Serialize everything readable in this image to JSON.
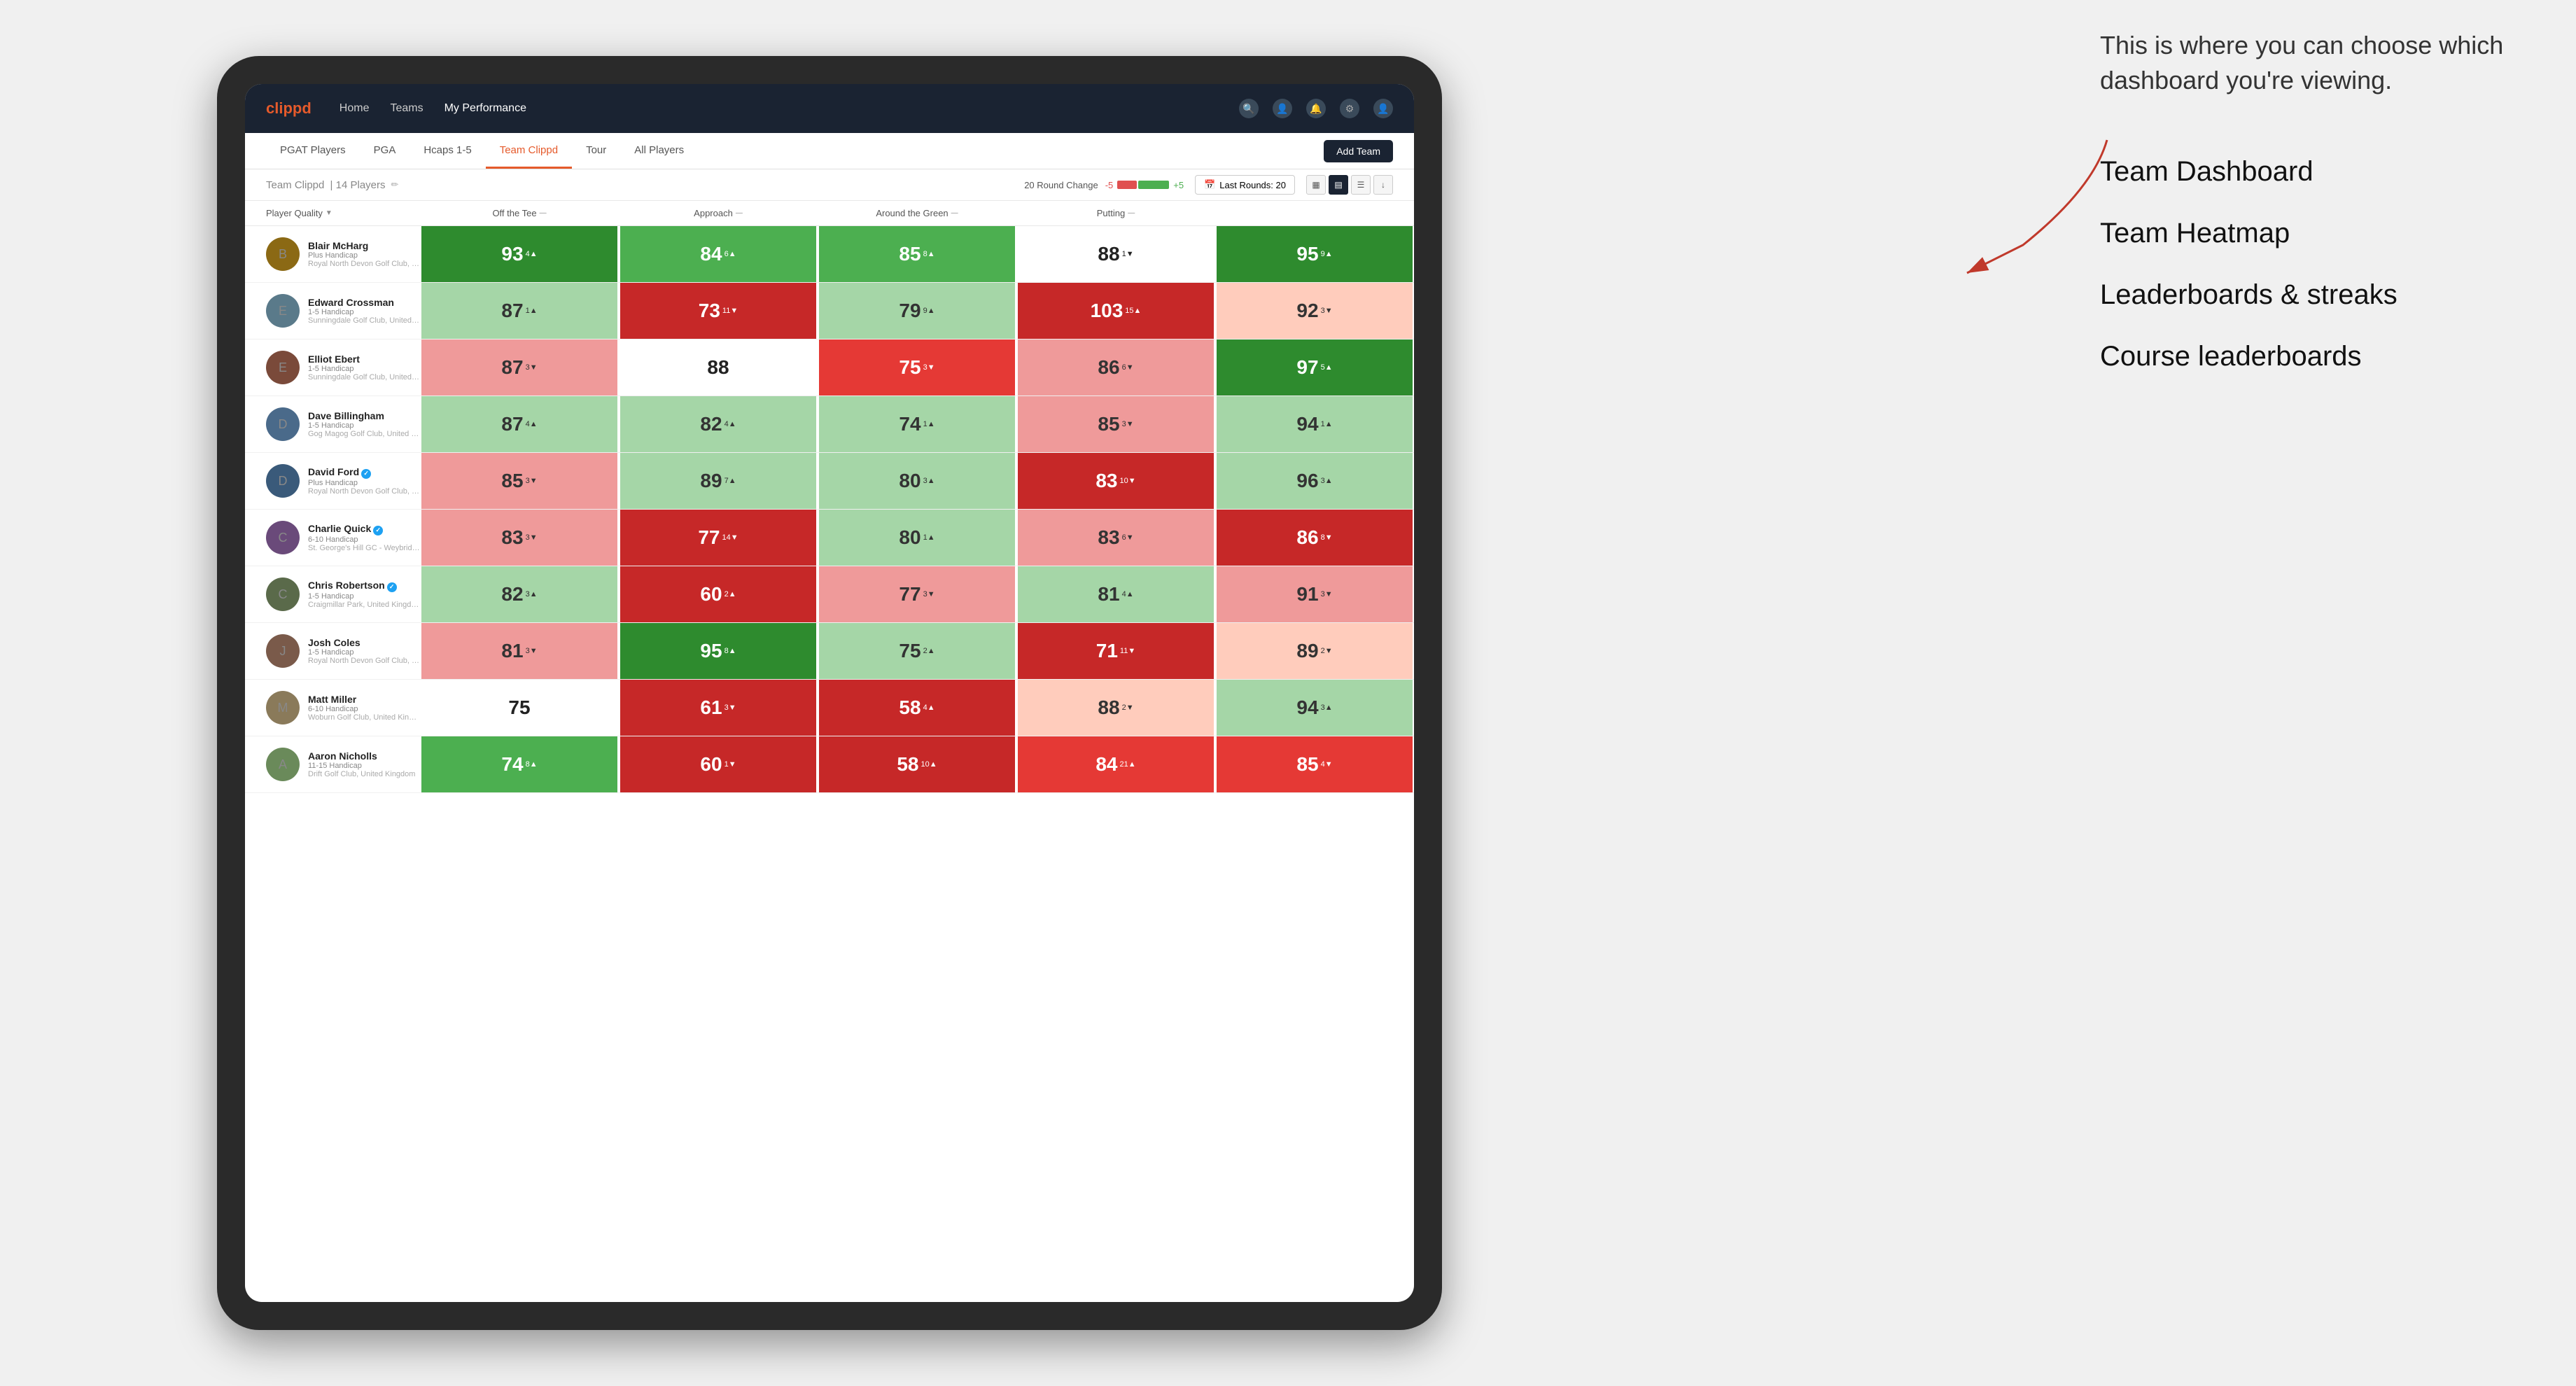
{
  "annotation": {
    "intro": "This is where you can choose which dashboard you're viewing.",
    "items": [
      "Team Dashboard",
      "Team Heatmap",
      "Leaderboards & streaks",
      "Course leaderboards"
    ]
  },
  "navbar": {
    "brand": "clippd",
    "links": [
      "Home",
      "Teams",
      "My Performance"
    ]
  },
  "subnav": {
    "tabs": [
      "PGAT Players",
      "PGA",
      "Hcaps 1-5",
      "Team Clippd",
      "Tour",
      "All Players"
    ],
    "active": "Team Clippd",
    "add_button": "Add Team"
  },
  "team_header": {
    "title": "Team Clippd",
    "count": "14 Players",
    "round_change_label": "20 Round Change",
    "round_change_neg": "-5",
    "round_change_pos": "+5",
    "last_rounds_label": "Last Rounds:",
    "last_rounds_value": "20"
  },
  "columns": {
    "player": "Player Quality",
    "tee": "Off the Tee",
    "approach": "Approach",
    "around": "Around the Green",
    "putting": "Putting"
  },
  "players": [
    {
      "name": "Blair McHarg",
      "handicap": "Plus Handicap",
      "club": "Royal North Devon Golf Club, United Kingdom",
      "avatar_color": "#8B6914",
      "scores": {
        "quality": {
          "val": "93",
          "change": "4",
          "dir": "up",
          "color": "green-dark"
        },
        "tee": {
          "val": "84",
          "change": "6",
          "dir": "up",
          "color": "green-med"
        },
        "approach": {
          "val": "85",
          "change": "8",
          "dir": "up",
          "color": "green-med"
        },
        "around": {
          "val": "88",
          "change": "1",
          "dir": "down",
          "color": "white"
        },
        "putting": {
          "val": "95",
          "change": "9",
          "dir": "up",
          "color": "green-dark"
        }
      }
    },
    {
      "name": "Edward Crossman",
      "handicap": "1-5 Handicap",
      "club": "Sunningdale Golf Club, United Kingdom",
      "avatar_color": "#5a7a8a",
      "scores": {
        "quality": {
          "val": "87",
          "change": "1",
          "dir": "up",
          "color": "green-light"
        },
        "tee": {
          "val": "73",
          "change": "11",
          "dir": "down",
          "color": "red-dark"
        },
        "approach": {
          "val": "79",
          "change": "9",
          "dir": "up",
          "color": "green-light"
        },
        "around": {
          "val": "103",
          "change": "15",
          "dir": "up",
          "color": "red-dark"
        },
        "putting": {
          "val": "92",
          "change": "3",
          "dir": "down",
          "color": "salmon"
        }
      }
    },
    {
      "name": "Elliot Ebert",
      "handicap": "1-5 Handicap",
      "club": "Sunningdale Golf Club, United Kingdom",
      "avatar_color": "#7a4a3a",
      "scores": {
        "quality": {
          "val": "87",
          "change": "3",
          "dir": "down",
          "color": "red-light"
        },
        "tee": {
          "val": "88",
          "change": "",
          "dir": "",
          "color": "white"
        },
        "approach": {
          "val": "75",
          "change": "3",
          "dir": "down",
          "color": "red-med"
        },
        "around": {
          "val": "86",
          "change": "6",
          "dir": "down",
          "color": "red-light"
        },
        "putting": {
          "val": "97",
          "change": "5",
          "dir": "up",
          "color": "green-dark"
        }
      }
    },
    {
      "name": "Dave Billingham",
      "handicap": "1-5 Handicap",
      "club": "Gog Magog Golf Club, United Kingdom",
      "avatar_color": "#4a6a8a",
      "scores": {
        "quality": {
          "val": "87",
          "change": "4",
          "dir": "up",
          "color": "green-light"
        },
        "tee": {
          "val": "82",
          "change": "4",
          "dir": "up",
          "color": "green-light"
        },
        "approach": {
          "val": "74",
          "change": "1",
          "dir": "up",
          "color": "green-light"
        },
        "around": {
          "val": "85",
          "change": "3",
          "dir": "down",
          "color": "red-light"
        },
        "putting": {
          "val": "94",
          "change": "1",
          "dir": "up",
          "color": "green-light"
        }
      }
    },
    {
      "name": "David Ford",
      "handicap": "Plus Handicap",
      "club": "Royal North Devon Golf Club, United Kingdom",
      "avatar_color": "#3a5a7a",
      "verified": true,
      "scores": {
        "quality": {
          "val": "85",
          "change": "3",
          "dir": "down",
          "color": "red-light"
        },
        "tee": {
          "val": "89",
          "change": "7",
          "dir": "up",
          "color": "green-light"
        },
        "approach": {
          "val": "80",
          "change": "3",
          "dir": "up",
          "color": "green-light"
        },
        "around": {
          "val": "83",
          "change": "10",
          "dir": "down",
          "color": "red-dark"
        },
        "putting": {
          "val": "96",
          "change": "3",
          "dir": "up",
          "color": "green-light"
        }
      }
    },
    {
      "name": "Charlie Quick",
      "handicap": "6-10 Handicap",
      "club": "St. George's Hill GC - Weybridge - Surrey, Uni...",
      "avatar_color": "#6a4a7a",
      "verified": true,
      "scores": {
        "quality": {
          "val": "83",
          "change": "3",
          "dir": "down",
          "color": "red-light"
        },
        "tee": {
          "val": "77",
          "change": "14",
          "dir": "down",
          "color": "red-dark"
        },
        "approach": {
          "val": "80",
          "change": "1",
          "dir": "up",
          "color": "green-light"
        },
        "around": {
          "val": "83",
          "change": "6",
          "dir": "down",
          "color": "red-light"
        },
        "putting": {
          "val": "86",
          "change": "8",
          "dir": "down",
          "color": "red-dark"
        }
      }
    },
    {
      "name": "Chris Robertson",
      "handicap": "1-5 Handicap",
      "club": "Craigmillar Park, United Kingdom",
      "avatar_color": "#5a6a4a",
      "verified": true,
      "scores": {
        "quality": {
          "val": "82",
          "change": "3",
          "dir": "up",
          "color": "green-light"
        },
        "tee": {
          "val": "60",
          "change": "2",
          "dir": "up",
          "color": "red-dark"
        },
        "approach": {
          "val": "77",
          "change": "3",
          "dir": "down",
          "color": "red-light"
        },
        "around": {
          "val": "81",
          "change": "4",
          "dir": "up",
          "color": "green-light"
        },
        "putting": {
          "val": "91",
          "change": "3",
          "dir": "down",
          "color": "red-light"
        }
      }
    },
    {
      "name": "Josh Coles",
      "handicap": "1-5 Handicap",
      "club": "Royal North Devon Golf Club, United Kingdom",
      "avatar_color": "#7a5a4a",
      "scores": {
        "quality": {
          "val": "81",
          "change": "3",
          "dir": "down",
          "color": "red-light"
        },
        "tee": {
          "val": "95",
          "change": "8",
          "dir": "up",
          "color": "green-dark"
        },
        "approach": {
          "val": "75",
          "change": "2",
          "dir": "up",
          "color": "green-light"
        },
        "around": {
          "val": "71",
          "change": "11",
          "dir": "down",
          "color": "red-dark"
        },
        "putting": {
          "val": "89",
          "change": "2",
          "dir": "down",
          "color": "salmon"
        }
      }
    },
    {
      "name": "Matt Miller",
      "handicap": "6-10 Handicap",
      "club": "Woburn Golf Club, United Kingdom",
      "avatar_color": "#8a7a5a",
      "scores": {
        "quality": {
          "val": "75",
          "change": "",
          "dir": "",
          "color": "white"
        },
        "tee": {
          "val": "61",
          "change": "3",
          "dir": "down",
          "color": "red-dark"
        },
        "approach": {
          "val": "58",
          "change": "4",
          "dir": "up",
          "color": "red-dark"
        },
        "around": {
          "val": "88",
          "change": "2",
          "dir": "down",
          "color": "salmon"
        },
        "putting": {
          "val": "94",
          "change": "3",
          "dir": "up",
          "color": "green-light"
        }
      }
    },
    {
      "name": "Aaron Nicholls",
      "handicap": "11-15 Handicap",
      "club": "Drift Golf Club, United Kingdom",
      "avatar_color": "#6a8a5a",
      "scores": {
        "quality": {
          "val": "74",
          "change": "8",
          "dir": "up",
          "color": "green-med"
        },
        "tee": {
          "val": "60",
          "change": "1",
          "dir": "down",
          "color": "red-dark"
        },
        "approach": {
          "val": "58",
          "change": "10",
          "dir": "up",
          "color": "red-dark"
        },
        "around": {
          "val": "84",
          "change": "21",
          "dir": "up",
          "color": "red-med"
        },
        "putting": {
          "val": "85",
          "change": "4",
          "dir": "down",
          "color": "red-med"
        }
      }
    }
  ]
}
